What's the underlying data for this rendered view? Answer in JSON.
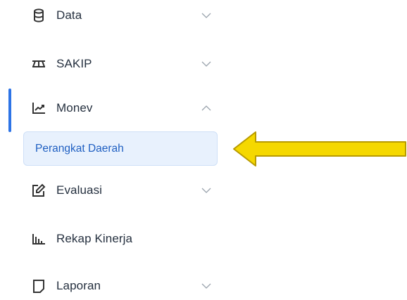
{
  "menu": {
    "items": [
      {
        "label": "Data",
        "icon": "database-icon",
        "chevron": "down"
      },
      {
        "label": "SAKIP",
        "icon": "flow-icon",
        "chevron": "down"
      },
      {
        "label": "Monev",
        "icon": "chart-line-icon",
        "chevron": "up"
      },
      {
        "label": "Evaluasi",
        "icon": "edit-icon",
        "chevron": "down"
      },
      {
        "label": "Rekap Kinerja",
        "icon": "bar-chart-icon"
      },
      {
        "label": "Laporan",
        "icon": "report-icon",
        "chevron": "down"
      }
    ],
    "active_sub_item": "Perangkat Daerah"
  },
  "colors": {
    "accent": "#2e74e6",
    "sub_bg": "#e8f1fd",
    "arrow": "#f5d800"
  }
}
